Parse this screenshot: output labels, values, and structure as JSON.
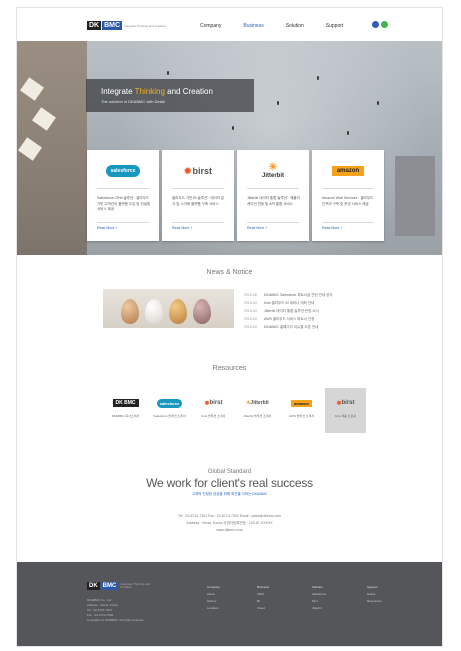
{
  "header": {
    "logo_dk": "DK",
    "logo_bmc": "BMC",
    "logo_tagline": "Integrate Thinking and Creation",
    "nav": [
      "Company",
      "Business",
      "Solution",
      "Support"
    ],
    "active_nav": "Business",
    "social_colors": [
      "#2d5fb6",
      "#3fb54a"
    ]
  },
  "hero": {
    "title_a": "Integrate",
    "title_b": "Thinking",
    "title_c": "and Creation",
    "subtitle": "The solution in DK&BMC with Detail"
  },
  "cards": [
    {
      "logo": "salesforce",
      "logo_color": "#1798c1",
      "text": "Salesforce CRM 솔루션 · 클라우드 기반 고객관리 플랫폼 도입 및 컨설팅 서비스 제공",
      "more": "Read More +"
    },
    {
      "logo": "birst",
      "logo_color": "#f15a24",
      "text": "클라우드 기반 BI 솔루션 · 데이터 분석 및 시각화 플랫폼 구축 서비스",
      "more": "Read More +"
    },
    {
      "logo": "Jitterbit",
      "logo_color": "#f7941d",
      "text": "Jitterbit 데이터 통합 솔루션 · 애플리케이션 연동 및 API 통합 서비스",
      "more": "Read More +"
    },
    {
      "logo": "amazon",
      "logo_color": "#f7a21c",
      "text": "Amazon Web Services · 클라우드 인프라 구축 및 운영 서비스 제공",
      "more": "Read More +"
    }
  ],
  "news": {
    "title": "News & Notice",
    "items": [
      {
        "date": "2015.05",
        "text": "DK&BMC Salesforce 파트너십 관련 안내 공지"
      },
      {
        "date": "2015.04",
        "text": "birst 클라우드 BI 세미나 개최 안내"
      },
      {
        "date": "2015.04",
        "text": "Jitterbit 데이터 통합 솔루션 런칭 소식"
      },
      {
        "date": "2015.03",
        "text": "AWS 클라우드 서비스 파트너 선정"
      },
      {
        "date": "2015.03",
        "text": "DK&BMC 홈페이지 리뉴얼 오픈 안내"
      }
    ]
  },
  "resources": {
    "title": "Resources",
    "items": [
      {
        "logo": "DK BMC",
        "caption": "DK&BMC 회사소개서"
      },
      {
        "logo": "salesforce",
        "caption": "Salesforce 솔루션 소개서"
      },
      {
        "logo": "birst",
        "caption": "birst 솔루션 소개서"
      },
      {
        "logo": "Jitterbit",
        "caption": "Jitterbit 솔루션 소개서"
      },
      {
        "logo": "amazon",
        "caption": "AWS 솔루션 소개서"
      },
      {
        "logo": "birst",
        "caption": "birst 제품 브로셔"
      }
    ],
    "selected_index": 5
  },
  "global": {
    "label": "Global Standard",
    "headline": "We work for client's real success",
    "sub": "고객의 진정한 성공을 위해 최선을 다하는 DK&BMC"
  },
  "contact": {
    "line1": "Tel : 02-6713-7301   Fax : 02-6713-7302   Email : sales@dkbmc.com",
    "line2": "Address : Seoul, Korea   사업자등록번호 : 120-87-XXXXX",
    "line3": "www.dkbmc.com"
  },
  "footer": {
    "logo_dk": "DK",
    "logo_bmc": "BMC",
    "tagline": "Integrate Thinking and Creation",
    "info": [
      "DK&BMC Co., Ltd.",
      "Address : Seoul, Korea",
      "Tel : 02-6713-7301",
      "Fax : 02-6713-7302",
      "Copyright (c) DK&BMC. All rights reserved."
    ],
    "columns": [
      {
        "head": "Company",
        "items": [
          "About",
          "History",
          "Location"
        ]
      },
      {
        "head": "Business",
        "items": [
          "CRM",
          "BI",
          "Cloud"
        ]
      },
      {
        "head": "Solution",
        "items": [
          "Salesforce",
          "birst",
          "Jitterbit"
        ]
      },
      {
        "head": "Support",
        "items": [
          "Notice",
          "Resources"
        ]
      }
    ]
  }
}
